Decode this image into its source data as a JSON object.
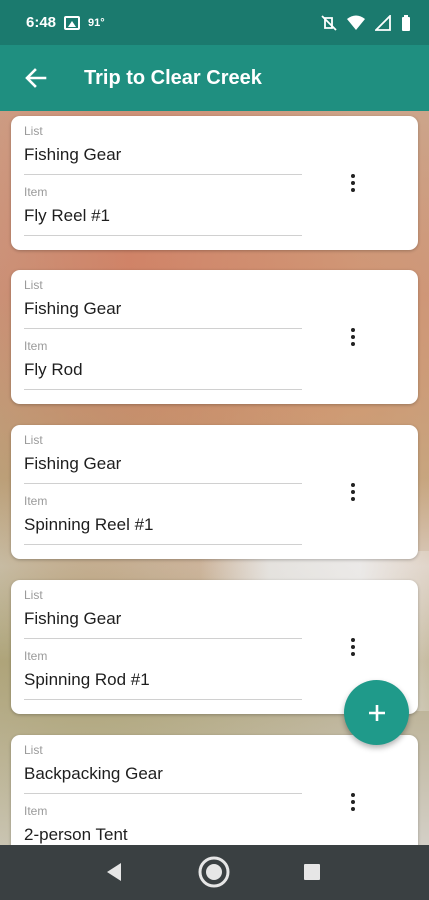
{
  "status_bar": {
    "time": "6:48",
    "temperature": "91°",
    "icons": [
      "gallery-icon",
      "vibrate-off-icon",
      "wifi-icon",
      "signal-icon",
      "battery-icon"
    ]
  },
  "app_bar": {
    "title": "Trip to Clear Creek",
    "back_icon": "arrow-back-icon",
    "background_color": "#1f8f80"
  },
  "cards": [
    {
      "list_label": "List",
      "list_value": "Fishing Gear",
      "item_label": "Item",
      "item_value": "Fly Reel #1"
    },
    {
      "list_label": "List",
      "list_value": "Fishing Gear",
      "item_label": "Item",
      "item_value": "Fly Rod"
    },
    {
      "list_label": "List",
      "list_value": "Fishing Gear",
      "item_label": "Item",
      "item_value": "Spinning Reel #1"
    },
    {
      "list_label": "List",
      "list_value": "Fishing Gear",
      "item_label": "Item",
      "item_value": "Spinning Rod #1"
    },
    {
      "list_label": "List",
      "list_value": "Backpacking Gear",
      "item_label": "Item",
      "item_value": "2-person Tent"
    }
  ],
  "fab": {
    "icon": "plus-icon",
    "color": "#1f9a8a"
  },
  "nav_bar": {
    "icons": [
      "back-triangle-icon",
      "home-circle-icon",
      "recents-square-icon"
    ]
  }
}
